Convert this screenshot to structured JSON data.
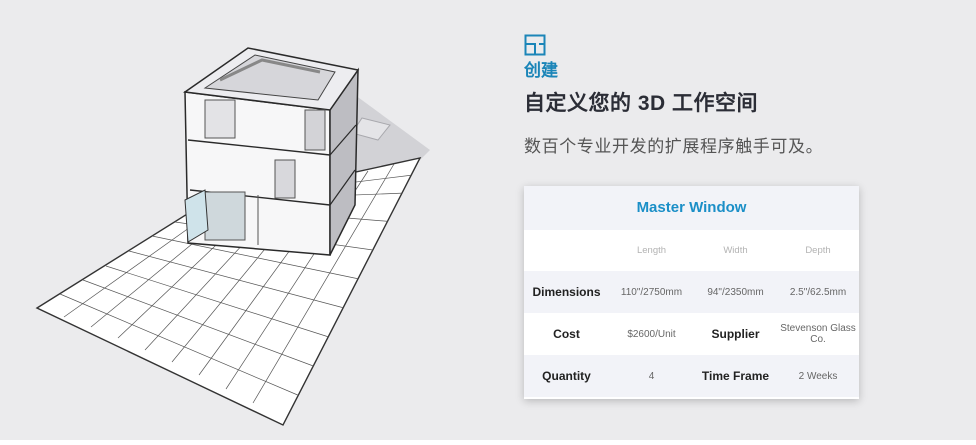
{
  "feature": {
    "icon": "floorplan-icon",
    "eyebrow": "创建",
    "headline": "自定义您的 3D 工作空间",
    "description": "数百个专业开发的扩展程序触手可及。"
  },
  "card": {
    "title": "Master Window",
    "columns": [
      "",
      "Length",
      "Width",
      "Depth"
    ],
    "rows": [
      [
        "Dimensions",
        "110\"/2750mm",
        "94\"/2350mm",
        "2.5\"/62.5mm"
      ],
      [
        "Cost",
        "$2600/Unit",
        "Supplier",
        "Stevenson Glass Co."
      ],
      [
        "Quantity",
        "4",
        "Time Frame",
        "2 Weeks"
      ]
    ]
  },
  "colors": {
    "accent": "#1b85b8",
    "background": "#ebebed",
    "building_shadow": "#cfcfd3"
  }
}
